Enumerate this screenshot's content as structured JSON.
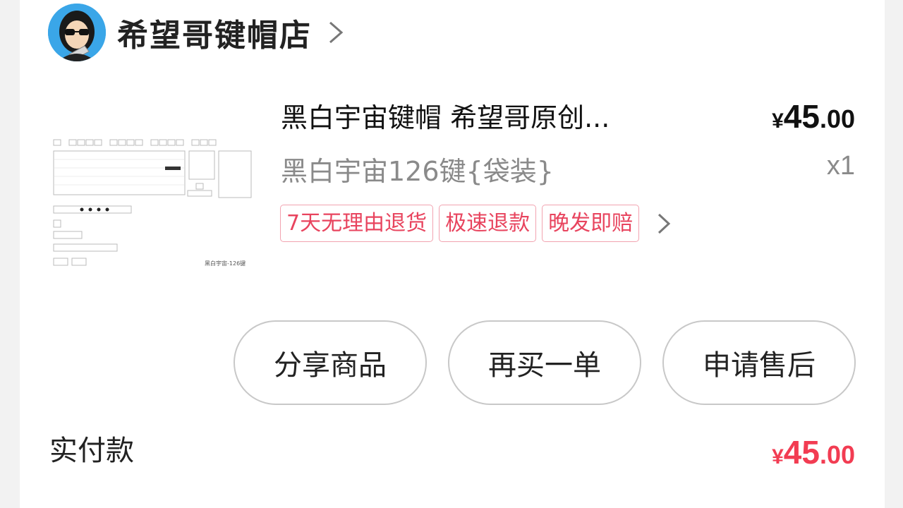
{
  "shop": {
    "name": "希望哥键帽店",
    "chevron_icon": "chevron-right-icon",
    "avatar_icon": "shop-avatar"
  },
  "product": {
    "title": "黑白宇宙键帽 希望哥原创...",
    "price": {
      "symbol": "¥",
      "integer": "45",
      "decimal": ".00"
    },
    "variant": "黑白宇宙126键{袋装}",
    "quantity": "x1",
    "thumbnail_caption": "黑白宇宙-126键",
    "tags": [
      "7天无理由退货",
      "极速退款",
      "晚发即赔"
    ]
  },
  "actions": {
    "share": "分享商品",
    "rebuy": "再买一单",
    "after_sale": "申请售后"
  },
  "payment": {
    "label": "实付款",
    "amount": {
      "symbol": "¥",
      "integer": "45",
      "decimal": ".00"
    }
  },
  "colors": {
    "accent": "#f23c52",
    "tag_border": "#f2a3b0",
    "tag_text": "#e8445e"
  }
}
